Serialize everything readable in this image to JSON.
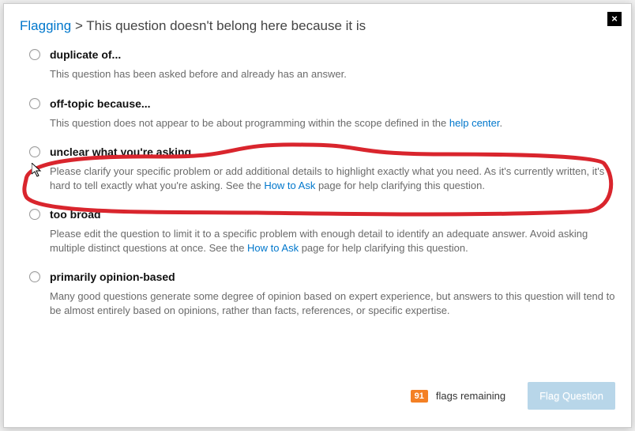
{
  "breadcrumb": {
    "root": "Flagging",
    "sep": " > ",
    "current": "This question doesn't belong here because it is"
  },
  "close_label": "×",
  "options": [
    {
      "title": "duplicate of...",
      "desc_parts": [
        {
          "text": "This question has been asked before and already has an answer."
        }
      ]
    },
    {
      "title": "off-topic because...",
      "desc_parts": [
        {
          "text": "This question does not appear to be about programming within the scope defined in the "
        },
        {
          "text": "help center",
          "link": true
        },
        {
          "text": "."
        }
      ]
    },
    {
      "title": "unclear what you're asking",
      "desc_parts": [
        {
          "text": "Please clarify your specific problem or add additional details to highlight exactly what you need. As it's currently written, it's hard to tell exactly what you're asking. See the "
        },
        {
          "text": "How to Ask",
          "link": true
        },
        {
          "text": " page for help clarifying this question."
        }
      ]
    },
    {
      "title": "too broad",
      "desc_parts": [
        {
          "text": "Please edit the question to limit it to a specific problem with enough detail to identify an adequate answer. Avoid asking multiple distinct questions at once. See the "
        },
        {
          "text": "How to Ask",
          "link": true
        },
        {
          "text": " page for help clarifying this question."
        }
      ]
    },
    {
      "title": "primarily opinion-based",
      "desc_parts": [
        {
          "text": "Many good questions generate some degree of opinion based on expert experience, but answers to this question will tend to be almost entirely based on opinions, rather than facts, references, or specific expertise."
        }
      ]
    }
  ],
  "footer": {
    "flags_count": "91",
    "flags_label": "flags remaining",
    "button_label": "Flag Question"
  },
  "colors": {
    "link": "#0077cc",
    "badge": "#f48024",
    "annotation": "#d9252d"
  }
}
